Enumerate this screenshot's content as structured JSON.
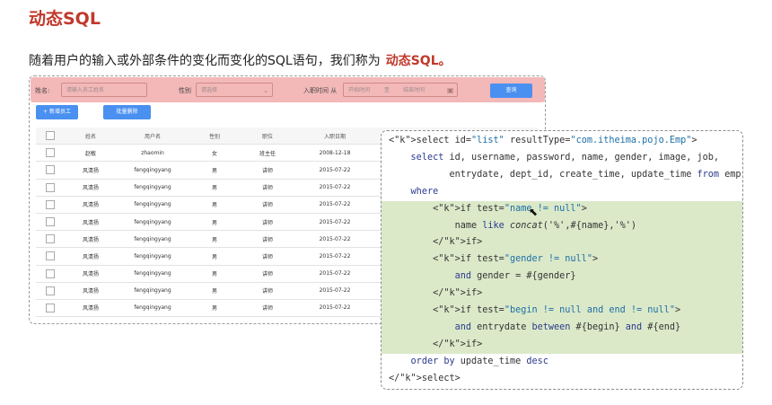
{
  "page": {
    "title": "动态SQL",
    "subtitle": "随着用户的输入或外部条件的变化而变化的SQL语句，我们称为",
    "subtitle_highlight": "动态SQL。"
  },
  "search": {
    "name_label": "姓名:",
    "name_placeholder": "请输入员工姓名",
    "gender_label": "性别",
    "gender_value": "请选择",
    "date_label": "入职时间 从",
    "start_placeholder": "开始时间",
    "to_label": "至",
    "end_placeholder": "结束时间",
    "query_button": "查询"
  },
  "toolbar": {
    "add_button": "+ 新增员工",
    "batch_delete_button": "批量删除"
  },
  "table": {
    "headers": [
      "",
      "姓名",
      "用户名",
      "性别",
      "职位",
      "入职日期"
    ],
    "rows": [
      [
        "赵敏",
        "zhaomin",
        "女",
        "班主任",
        "2008-12-18"
      ],
      [
        "风清扬",
        "fengqingyang",
        "男",
        "讲师",
        "2015-07-22"
      ],
      [
        "风清扬",
        "fengqingyang",
        "男",
        "讲师",
        "2015-07-22"
      ],
      [
        "风清扬",
        "fengqingyang",
        "男",
        "讲师",
        "2015-07-22"
      ],
      [
        "风清扬",
        "fengqingyang",
        "男",
        "讲师",
        "2015-07-22"
      ],
      [
        "风清扬",
        "fengqingyang",
        "男",
        "讲师",
        "2015-07-22"
      ],
      [
        "风清扬",
        "fengqingyang",
        "男",
        "讲师",
        "2015-07-22"
      ],
      [
        "风清扬",
        "fengqingyang",
        "男",
        "讲师",
        "2015-07-22"
      ],
      [
        "风清扬",
        "fengqingyang",
        "男",
        "讲师",
        "2015-07-22"
      ],
      [
        "风清扬",
        "fengqingyang",
        "男",
        "讲师",
        "2015-07-22"
      ]
    ]
  },
  "code": {
    "lines": [
      "<select id=\"list\" resultType=\"com.itheima.pojo.Emp\">",
      "    select id, username, password, name, gender, image, job,",
      "           entrydate, dept_id, create_time, update_time from emp",
      "    where",
      "        <if test=\"name != null\">",
      "            name like concat('%',#{name},'%')",
      "        </if>",
      "        <if test=\"gender != null\">",
      "            and gender = #{gender}",
      "        </if>",
      "        <if test=\"begin != null and end != null\">",
      "            and entrydate between #{begin} and #{end}",
      "        </if>",
      "    order by update_time desc",
      "</select>"
    ]
  },
  "colors": {
    "accent_red": "#c0392b",
    "search_bar_bg": "#f3b8b8",
    "button_blue": "#4a90f0",
    "highlight_green": "#dbe9c9"
  }
}
